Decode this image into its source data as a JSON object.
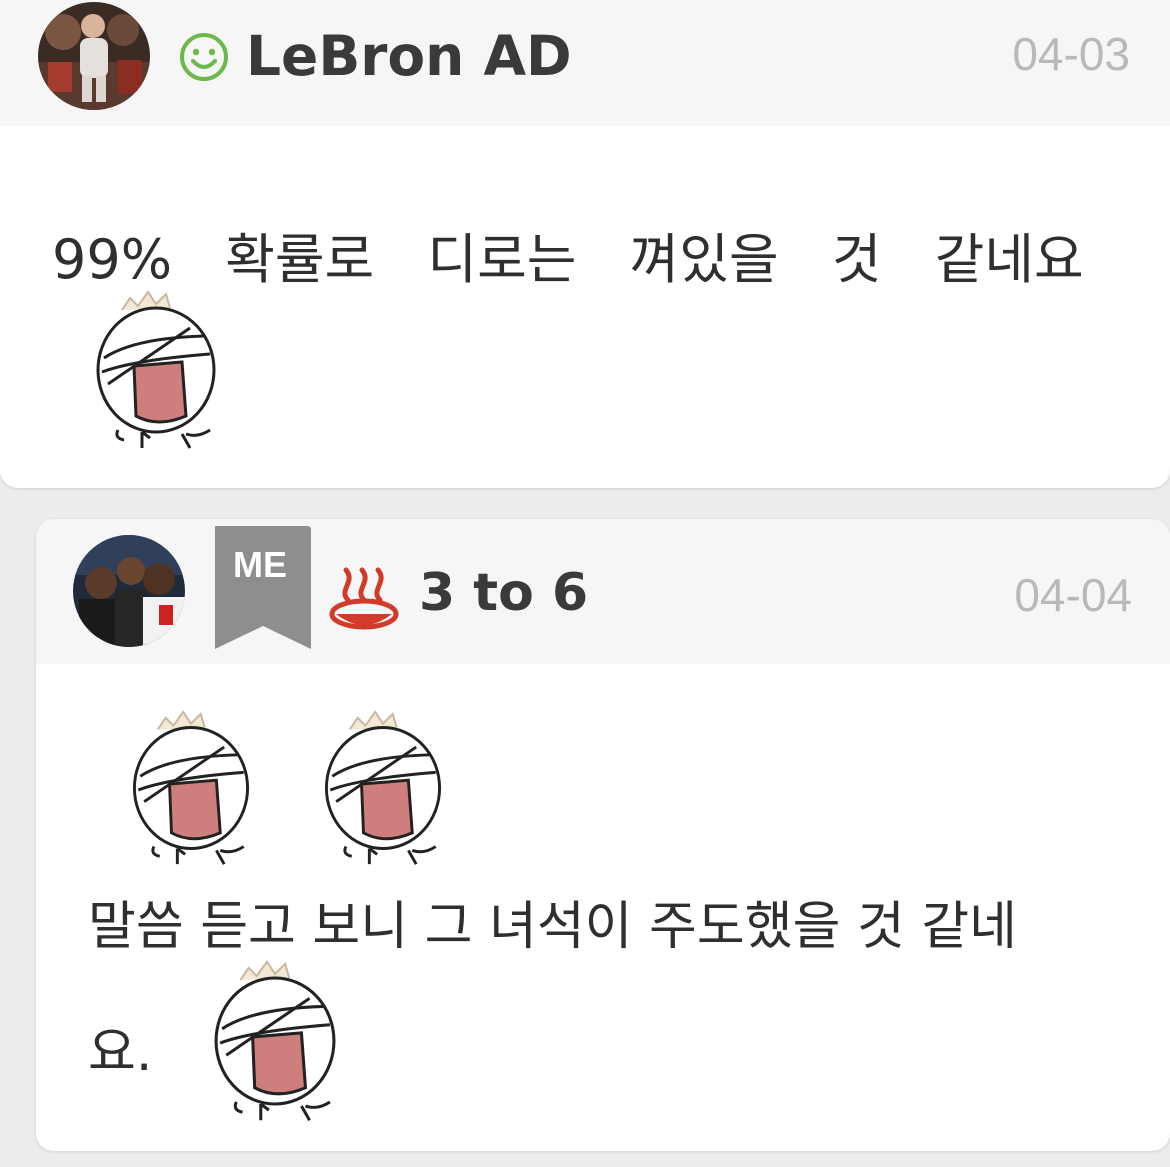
{
  "comments": [
    {
      "username": "LeBron AD",
      "date": "04-03",
      "level_icon": "green-smiley-icon",
      "text": "99% 확률로 디로는 껴있을 것 같네요",
      "emoticon": "crying-onion-emoticon"
    },
    {
      "badge_label": "ME",
      "username": "3 to 6",
      "date": "04-04",
      "level_icon": "hot-spring-icon",
      "text_line_1": "말씀 듣고 보니 그 녀석이 주도했을 것 같네",
      "text_line_2": "요.",
      "emoticon": "crying-onion-emoticon"
    }
  ],
  "colors": {
    "background": "#ececec",
    "card": "#ffffff",
    "header": "#f6f6f6",
    "username": "#3a3a3a",
    "date": "#b9b9b9",
    "smiley": "#6cb84a",
    "hot_spring": "#d23a2a",
    "me_badge": "#8e8e8e"
  }
}
